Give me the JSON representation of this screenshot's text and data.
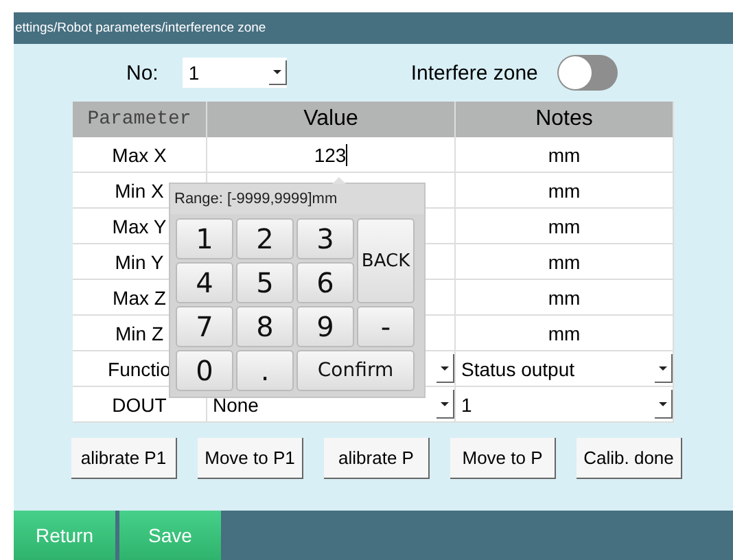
{
  "breadcrumb": "ettings/Robot parameters/interference zone",
  "no_field": {
    "label": "No:",
    "value": "1"
  },
  "interfere_zone": {
    "label": "Interfere zone",
    "on": false
  },
  "table": {
    "columns": [
      "Parameter",
      "Value",
      "Notes"
    ],
    "rows": [
      {
        "label": "Max X",
        "value": "123",
        "kind": "input",
        "notes": "mm"
      },
      {
        "label": "Min X",
        "kind": "covered",
        "notes": "mm"
      },
      {
        "label": "Max Y",
        "kind": "covered",
        "notes": "mm"
      },
      {
        "label": "Min Y",
        "kind": "covered",
        "notes": "mm"
      },
      {
        "label": "Max Z",
        "kind": "covered",
        "notes": "mm"
      },
      {
        "label": "Min Z",
        "kind": "covered",
        "notes": "mm"
      },
      {
        "label": "Functio",
        "kind": "select",
        "notes": "Status output"
      },
      {
        "label": "DOUT",
        "value": "None",
        "kind": "select",
        "notes": "1"
      }
    ]
  },
  "keypad": {
    "range": "Range: [-9999,9999]mm",
    "keys": [
      {
        "label": "1",
        "kind": "digit"
      },
      {
        "label": "2",
        "kind": "digit"
      },
      {
        "label": "3",
        "kind": "digit"
      },
      {
        "label": "BACK",
        "kind": "tall"
      },
      {
        "label": "4",
        "kind": "digit"
      },
      {
        "label": "5",
        "kind": "digit"
      },
      {
        "label": "6",
        "kind": "digit"
      },
      {
        "label": "7",
        "kind": "digit"
      },
      {
        "label": "8",
        "kind": "digit"
      },
      {
        "label": "9",
        "kind": "digit"
      },
      {
        "label": "-",
        "kind": "digit"
      },
      {
        "label": "0",
        "kind": "digit"
      },
      {
        "label": ".",
        "kind": "digit"
      },
      {
        "label": "Confirm",
        "kind": "wide"
      }
    ]
  },
  "actions": [
    "alibrate P1",
    "Move to P1",
    "alibrate P",
    "Move to P",
    "Calib. done"
  ],
  "footer": [
    "Return",
    "Save"
  ]
}
